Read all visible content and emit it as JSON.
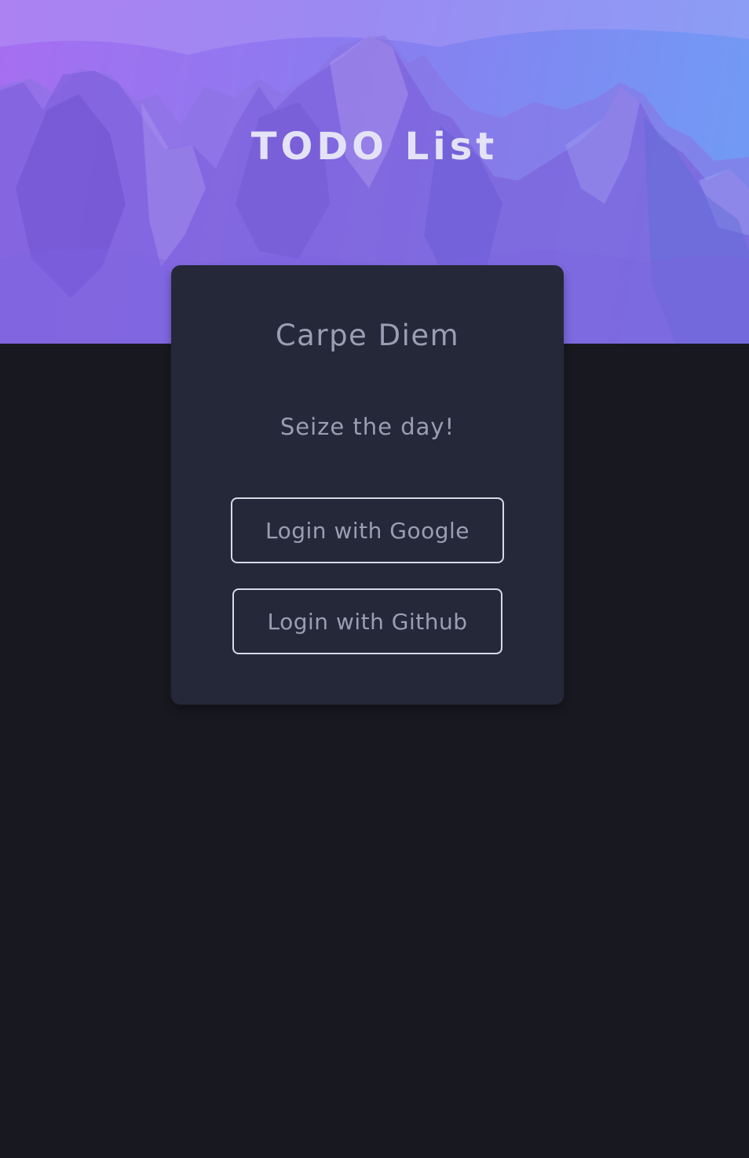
{
  "header": {
    "title": "TODO List",
    "background": "mountains-photo"
  },
  "card": {
    "title": "Carpe Diem",
    "subtitle": "Seize the day!",
    "google_button_label": "Login with Google",
    "github_button_label": "Login with Github"
  },
  "colors": {
    "page_background": "#181820",
    "card_background": "#252839",
    "hero_gradient_start": "#a66ef0",
    "hero_gradient_end": "#6f9df5",
    "text_muted": "#9c9db2",
    "title_text": "#e4e2f6",
    "button_border": "#d9d9e6"
  }
}
